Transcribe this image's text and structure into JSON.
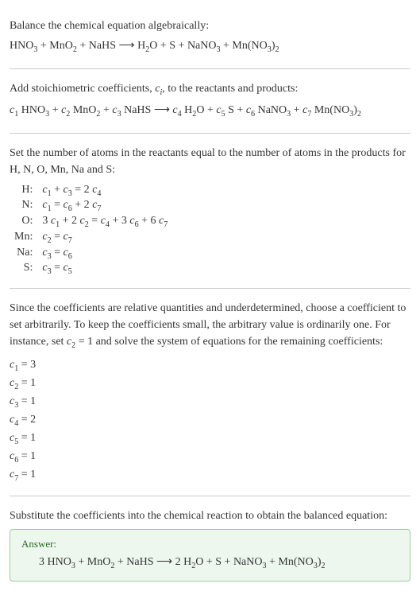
{
  "section1": {
    "title": "Balance the chemical equation algebraically:",
    "eq_parts": [
      "HNO",
      "3",
      " + MnO",
      "2",
      " + NaHS  ⟶  H",
      "2",
      "O + S + NaNO",
      "3",
      " + Mn(NO",
      "3",
      ")",
      "2"
    ]
  },
  "section2": {
    "title_a": "Add stoichiometric coefficients, ",
    "title_ci": "c",
    "title_i": "i",
    "title_b": ", to the reactants and products:",
    "c1": "c",
    "n1": "1",
    "t1": " HNO",
    "s1": "3",
    "p1": " + ",
    "c2": "c",
    "n2": "2",
    "t2": " MnO",
    "s2": "2",
    "p2": " + ",
    "c3": "c",
    "n3": "3",
    "t3": " NaHS  ⟶  ",
    "c4": "c",
    "n4": "4",
    "t4": " H",
    "s4": "2",
    "t4b": "O + ",
    "c5": "c",
    "n5": "5",
    "t5": " S + ",
    "c6": "c",
    "n6": "6",
    "t6": " NaNO",
    "s6": "3",
    "p6": " + ",
    "c7": "c",
    "n7": "7",
    "t7": " Mn(NO",
    "s7": "3",
    "t7b": ")",
    "s7b": "2"
  },
  "section3": {
    "title": "Set the number of atoms in the reactants equal to the number of atoms in the products for H, N, O, Mn, Na and S:",
    "rows": [
      {
        "el": "H:",
        "lhs_a": "c",
        "lhs_an": "1",
        "lhs_b": " + ",
        "lhs_c": "c",
        "lhs_cn": "3",
        "eq": " = 2 ",
        "rhs_a": "c",
        "rhs_an": "4"
      },
      {
        "el": "N:",
        "lhs_a": "c",
        "lhs_an": "1",
        "eq": " = ",
        "rhs_a": "c",
        "rhs_an": "6",
        "rhs_b": " + 2 ",
        "rhs_c": "c",
        "rhs_cn": "7"
      },
      {
        "el": "O:",
        "pre": "3 ",
        "lhs_a": "c",
        "lhs_an": "1",
        "lhs_b": " + 2 ",
        "lhs_c": "c",
        "lhs_cn": "2",
        "eq": " = ",
        "rhs_a": "c",
        "rhs_an": "4",
        "rhs_b": " + 3 ",
        "rhs_c": "c",
        "rhs_cn": "6",
        "rhs_d": " + 6 ",
        "rhs_e": "c",
        "rhs_en": "7"
      },
      {
        "el": "Mn:",
        "lhs_a": "c",
        "lhs_an": "2",
        "eq": " = ",
        "rhs_a": "c",
        "rhs_an": "7"
      },
      {
        "el": "Na:",
        "lhs_a": "c",
        "lhs_an": "3",
        "eq": " = ",
        "rhs_a": "c",
        "rhs_an": "6"
      },
      {
        "el": "S:",
        "lhs_a": "c",
        "lhs_an": "3",
        "eq": " = ",
        "rhs_a": "c",
        "rhs_an": "5"
      }
    ]
  },
  "section4": {
    "title_a": "Since the coefficients are relative quantities and underdetermined, choose a coefficient to set arbitrarily. To keep the coefficients small, the arbitrary value is ordinarily one. For instance, set ",
    "cv": "c",
    "cn": "2",
    "title_b": " = 1 and solve the system of equations for the remaining coefficients:",
    "coefs": [
      {
        "c": "c",
        "n": "1",
        "v": " = 3"
      },
      {
        "c": "c",
        "n": "2",
        "v": " = 1"
      },
      {
        "c": "c",
        "n": "3",
        "v": " = 1"
      },
      {
        "c": "c",
        "n": "4",
        "v": " = 2"
      },
      {
        "c": "c",
        "n": "5",
        "v": " = 1"
      },
      {
        "c": "c",
        "n": "6",
        "v": " = 1"
      },
      {
        "c": "c",
        "n": "7",
        "v": " = 1"
      }
    ]
  },
  "section5": {
    "title": "Substitute the coefficients into the chemical reaction to obtain the balanced equation:",
    "answer_label": "Answer:",
    "eq_parts": [
      "3 HNO",
      "3",
      " + MnO",
      "2",
      " + NaHS  ⟶  2 H",
      "2",
      "O + S + NaNO",
      "3",
      " + Mn(NO",
      "3",
      ")",
      "2"
    ]
  }
}
